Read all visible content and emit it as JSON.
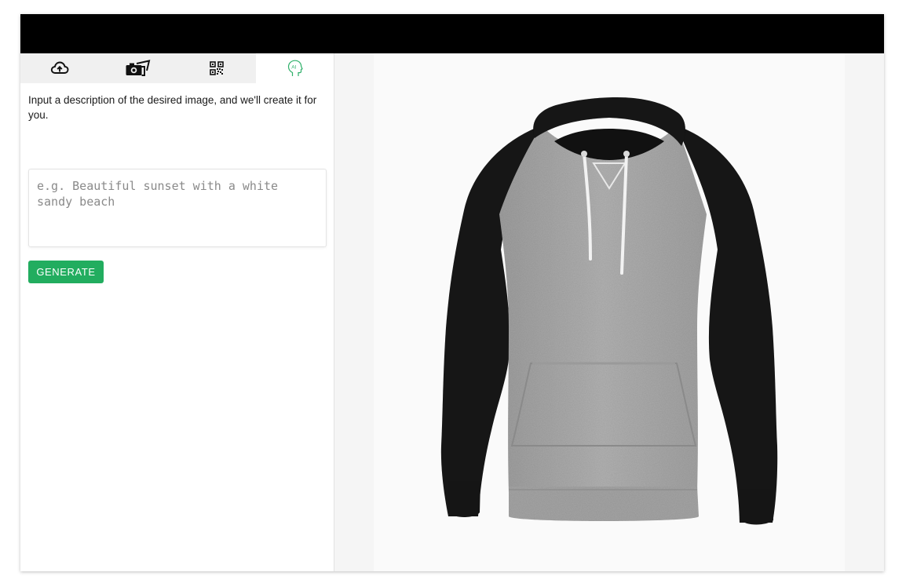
{
  "tabs": [
    {
      "id": "upload",
      "icon": "cloud-upload-icon",
      "active": false
    },
    {
      "id": "photos",
      "icon": "camera-photos-icon",
      "active": false
    },
    {
      "id": "qr",
      "icon": "qr-code-icon",
      "active": false
    },
    {
      "id": "ai",
      "icon": "ai-head-icon",
      "active": true
    }
  ],
  "ai_panel": {
    "description": "Input a description of the desired image, and we'll create it for you.",
    "prompt_value": "",
    "prompt_placeholder": "e.g. Beautiful sunset with a white sandy beach",
    "generate_label": "GENERATE"
  },
  "product": {
    "name": "raglan-hoodie",
    "body_color": "#ababab",
    "sleeve_color": "#1f1f1f",
    "drawstring_color": "#f2f2f2"
  },
  "colors": {
    "accent": "#22ad5f",
    "topbar": "#000000",
    "ai_icon": "#2fb06a"
  }
}
